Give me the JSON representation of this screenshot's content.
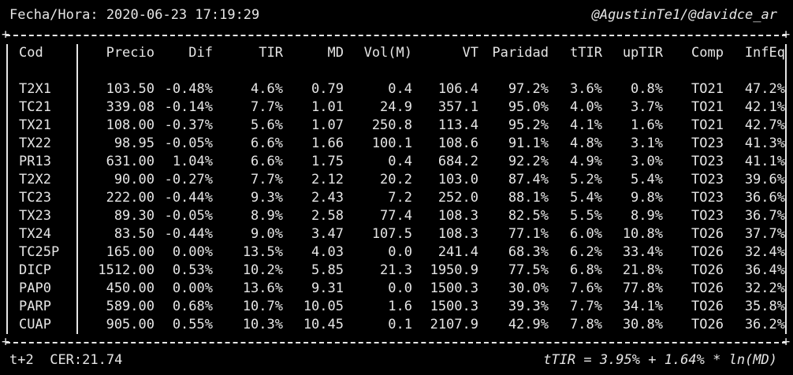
{
  "header": {
    "datetime": "Fecha/Hora: 2020-06-23 17:19:29",
    "credits": "@AgustinTe1/@davidce_ar"
  },
  "footer": {
    "settlement": "t+2",
    "cer": "CER:21.74",
    "formula": "tTIR = 3.95% + 1.64% * ln(MD)"
  },
  "table": {
    "columns": [
      "Cod",
      "Precio",
      "Dif",
      "TIR",
      "MD",
      "Vol(M)",
      "VT",
      "Paridad",
      "tTIR",
      "upTIR",
      "Comp",
      "InfEq"
    ],
    "rows": [
      [
        "T2X1",
        "103.50",
        "-0.48%",
        "4.6%",
        "0.79",
        "0.4",
        "106.4",
        "97.2%",
        "3.6%",
        "0.8%",
        "TO21",
        "47.2%"
      ],
      [
        "TC21",
        "339.08",
        "-0.14%",
        "7.7%",
        "1.01",
        "24.9",
        "357.1",
        "95.0%",
        "4.0%",
        "3.7%",
        "TO21",
        "42.1%"
      ],
      [
        "TX21",
        "108.00",
        "-0.37%",
        "5.6%",
        "1.07",
        "250.8",
        "113.4",
        "95.2%",
        "4.1%",
        "1.6%",
        "TO21",
        "42.7%"
      ],
      [
        "TX22",
        "98.95",
        "-0.05%",
        "6.6%",
        "1.66",
        "100.1",
        "108.6",
        "91.1%",
        "4.8%",
        "3.1%",
        "TO23",
        "41.3%"
      ],
      [
        "PR13",
        "631.00",
        "1.04%",
        "6.6%",
        "1.75",
        "0.4",
        "684.2",
        "92.2%",
        "4.9%",
        "3.0%",
        "TO23",
        "41.1%"
      ],
      [
        "T2X2",
        "90.00",
        "-0.27%",
        "7.7%",
        "2.12",
        "20.2",
        "103.0",
        "87.4%",
        "5.2%",
        "5.4%",
        "TO23",
        "39.6%"
      ],
      [
        "TC23",
        "222.00",
        "-0.44%",
        "9.3%",
        "2.43",
        "7.2",
        "252.0",
        "88.1%",
        "5.4%",
        "9.8%",
        "TO23",
        "36.6%"
      ],
      [
        "TX23",
        "89.30",
        "-0.05%",
        "8.9%",
        "2.58",
        "77.4",
        "108.3",
        "82.5%",
        "5.5%",
        "8.9%",
        "TO23",
        "36.7%"
      ],
      [
        "TX24",
        "83.50",
        "-0.44%",
        "9.0%",
        "3.47",
        "107.5",
        "108.3",
        "77.1%",
        "6.0%",
        "10.8%",
        "TO26",
        "37.7%"
      ],
      [
        "TC25P",
        "165.00",
        "0.00%",
        "13.5%",
        "4.03",
        "0.0",
        "241.4",
        "68.3%",
        "6.2%",
        "33.4%",
        "TO26",
        "32.4%"
      ],
      [
        "DICP",
        "1512.00",
        "0.53%",
        "10.2%",
        "5.85",
        "21.3",
        "1950.9",
        "77.5%",
        "6.8%",
        "21.8%",
        "TO26",
        "36.4%"
      ],
      [
        "PAP0",
        "450.00",
        "0.00%",
        "13.6%",
        "9.31",
        "0.0",
        "1500.3",
        "30.0%",
        "7.6%",
        "77.8%",
        "TO26",
        "32.2%"
      ],
      [
        "PARP",
        "589.00",
        "0.68%",
        "10.7%",
        "10.05",
        "1.6",
        "1500.3",
        "39.3%",
        "7.7%",
        "34.1%",
        "TO26",
        "35.8%"
      ],
      [
        "CUAP",
        "905.00",
        "0.55%",
        "10.3%",
        "10.45",
        "0.1",
        "2107.9",
        "42.9%",
        "7.8%",
        "30.8%",
        "TO26",
        "36.2%"
      ]
    ]
  }
}
